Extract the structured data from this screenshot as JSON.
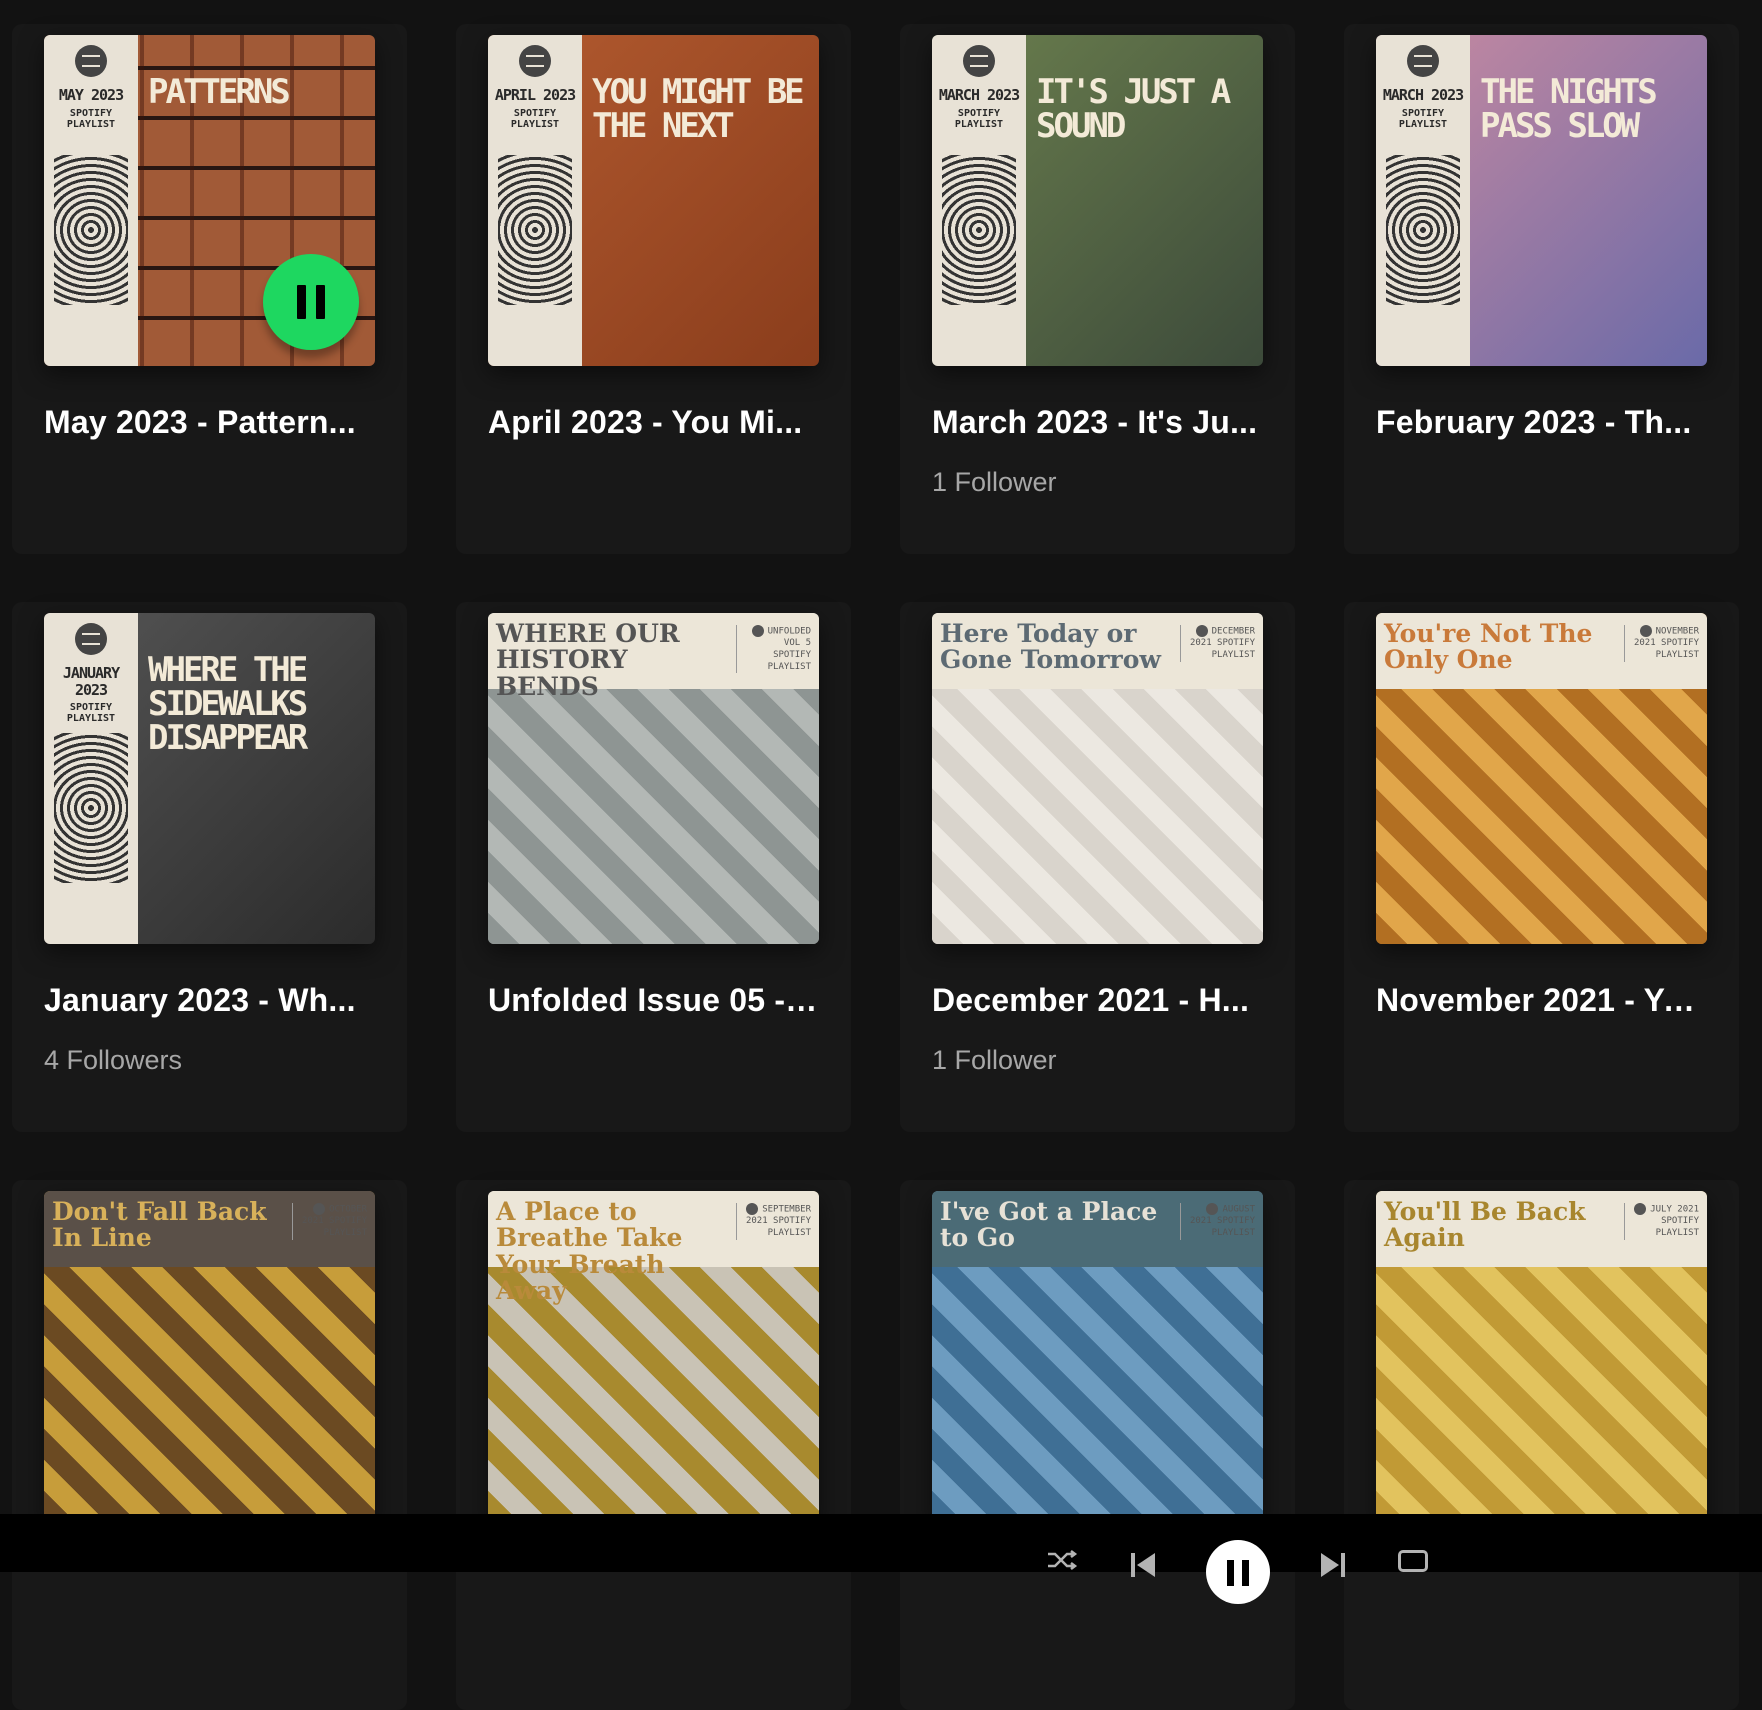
{
  "playlists": [
    {
      "title": "May 2023 - Pattern...",
      "subtitle": "",
      "cover": {
        "month": "MAY 2023",
        "sub": "SPOTIFY PLAYLIST",
        "headline": "PATTERNS",
        "bg": "#8b4a2b",
        "accent": "#a15a37"
      },
      "playing": true
    },
    {
      "title": "April 2023 - You Mi...",
      "subtitle": "",
      "cover": {
        "month": "APRIL 2023",
        "sub": "SPOTIFY PLAYLIST",
        "headline": "YOU MIGHT BE THE NEXT",
        "bg": "#8a3d1c",
        "accent": "#b25a2f"
      },
      "playing": false
    },
    {
      "title": "March 2023 - It's Ju...",
      "subtitle": "1 Follower",
      "cover": {
        "month": "MARCH 2023",
        "sub": "SPOTIFY PLAYLIST",
        "headline": "IT'S JUST A SOUND",
        "bg": "#3c4a3a",
        "accent": "#6b7f4e"
      },
      "playing": false
    },
    {
      "title": "February 2023 - Th...",
      "subtitle": "",
      "cover": {
        "month": "MARCH 2023",
        "sub": "SPOTIFY PLAYLIST",
        "headline": "THE NIGHTS PASS SLOW",
        "bg": "#6a6aa8",
        "accent": "#c98aa0"
      },
      "playing": false
    },
    {
      "title": "January 2023 - Wh...",
      "subtitle": "4 Followers",
      "cover": {
        "month": "JANUARY 2023",
        "sub": "SPOTIFY PLAYLIST",
        "headline": "WHERE THE SIDEWALKS DISAPPEAR",
        "bg": "#2b2b2b",
        "accent": "#555555"
      },
      "playing": false
    },
    {
      "title": "Unfolded Issue 05 - ...",
      "subtitle": "",
      "cover": {
        "band_title": "WHERE OUR HISTORY BENDS",
        "meta": "UNFOLDED VOL 5 SPOTIFY PLAYLIST",
        "bg": "#8e9593",
        "accent": "#b3b8b5"
      },
      "playing": false
    },
    {
      "title": "December 2021 - H...",
      "subtitle": "1 Follower",
      "cover": {
        "band_title": "Here Today or Gone Tomorrow",
        "meta": "DECEMBER 2021 SPOTIFY PLAYLIST",
        "bg": "#d9d4cc",
        "accent": "#ece8e1",
        "title_color": "#5d6a73"
      },
      "playing": false
    },
    {
      "title": "November 2021 - Yo...",
      "subtitle": "",
      "cover": {
        "band_title": "You're Not The Only One",
        "meta": "NOVEMBER 2021 SPOTIFY PLAYLIST",
        "bg": "#b26f22",
        "accent": "#e1a64a",
        "title_color": "#c97a3a"
      },
      "playing": false
    },
    {
      "title": "",
      "subtitle": "",
      "cover": {
        "band_title": "Don't Fall Back In Line",
        "meta": "OCTOBER 2021 SPOTIFY PLAYLIST",
        "bg": "#6b4a22",
        "accent": "#c79d3a",
        "title_color": "#d8b15a",
        "band_bg": "#5a5048"
      },
      "playing": false
    },
    {
      "title": "",
      "subtitle": "",
      "cover": {
        "band_title": "A Place to Breathe Take Your Breath Away",
        "meta": "SEPTEMBER 2021 SPOTIFY PLAYLIST",
        "bg": "#a88a2e",
        "accent": "#c9c3b5",
        "title_color": "#b98a3a"
      },
      "playing": false
    },
    {
      "title": "",
      "subtitle": "",
      "cover": {
        "band_title": "I've Got a Place to Go",
        "meta": "AUGUST 2021 SPOTIFY PLAYLIST",
        "bg": "#3f6f95",
        "accent": "#6d9cc0",
        "title_color": "#e6e1d6",
        "band_bg": "#4b6b76"
      },
      "playing": false
    },
    {
      "title": "",
      "subtitle": "",
      "cover": {
        "band_title": "You'll Be Back Again",
        "meta": "JULY 2021 SPOTIFY PLAYLIST",
        "bg": "#c19a35",
        "accent": "#e2c35e",
        "title_color": "#a8862e"
      },
      "playing": false
    }
  ],
  "player": {
    "shuffle": "shuffle-icon",
    "prev": "skip-back-icon",
    "pause": "pause-icon",
    "next": "skip-forward-icon",
    "repeat": "repeat-icon"
  },
  "colors": {
    "background": "#121212",
    "card": "#181818",
    "accent_green": "#1ed760",
    "subtitle": "#a7a7a7"
  }
}
